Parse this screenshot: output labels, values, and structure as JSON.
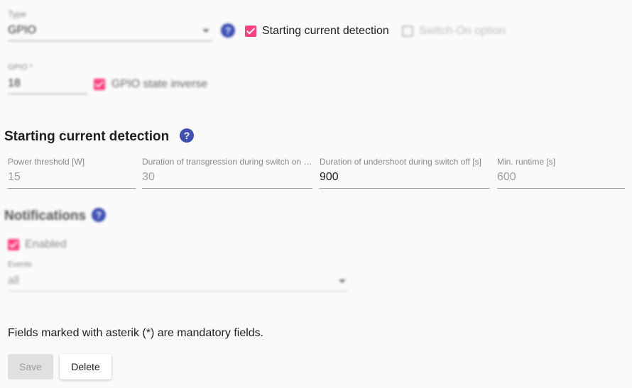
{
  "type_field": {
    "label": "Type",
    "value": "GPIO"
  },
  "starting_current_checkbox": {
    "label": "Starting current detection",
    "checked": true
  },
  "switch_on_option": {
    "label": "Switch-On option",
    "checked": false
  },
  "gpio_field": {
    "label": "GPIO *",
    "value": "18"
  },
  "gpio_inverse": {
    "label": "GPIO state inverse",
    "checked": true
  },
  "section_starting": {
    "title": "Starting current detection",
    "fields": [
      {
        "label": "Power threshold [W]",
        "value": "15"
      },
      {
        "label": "Duration of transgression during switch on …",
        "value": "30"
      },
      {
        "label": "Duration of undershoot during switch off [s]",
        "value": "900"
      },
      {
        "label": "Min. runtime [s]",
        "value": "600"
      }
    ]
  },
  "notifications": {
    "title": "Notifications",
    "enabled_label": "Enabled",
    "events_label": "Events",
    "events_value": "all"
  },
  "mandatory_note": "Fields marked with asterik (*) are mandatory fields.",
  "buttons": {
    "save": "Save",
    "delete": "Delete"
  },
  "help_glyph": "?",
  "colors": {
    "accent": "#ff4081",
    "primary": "#3f51b5"
  }
}
